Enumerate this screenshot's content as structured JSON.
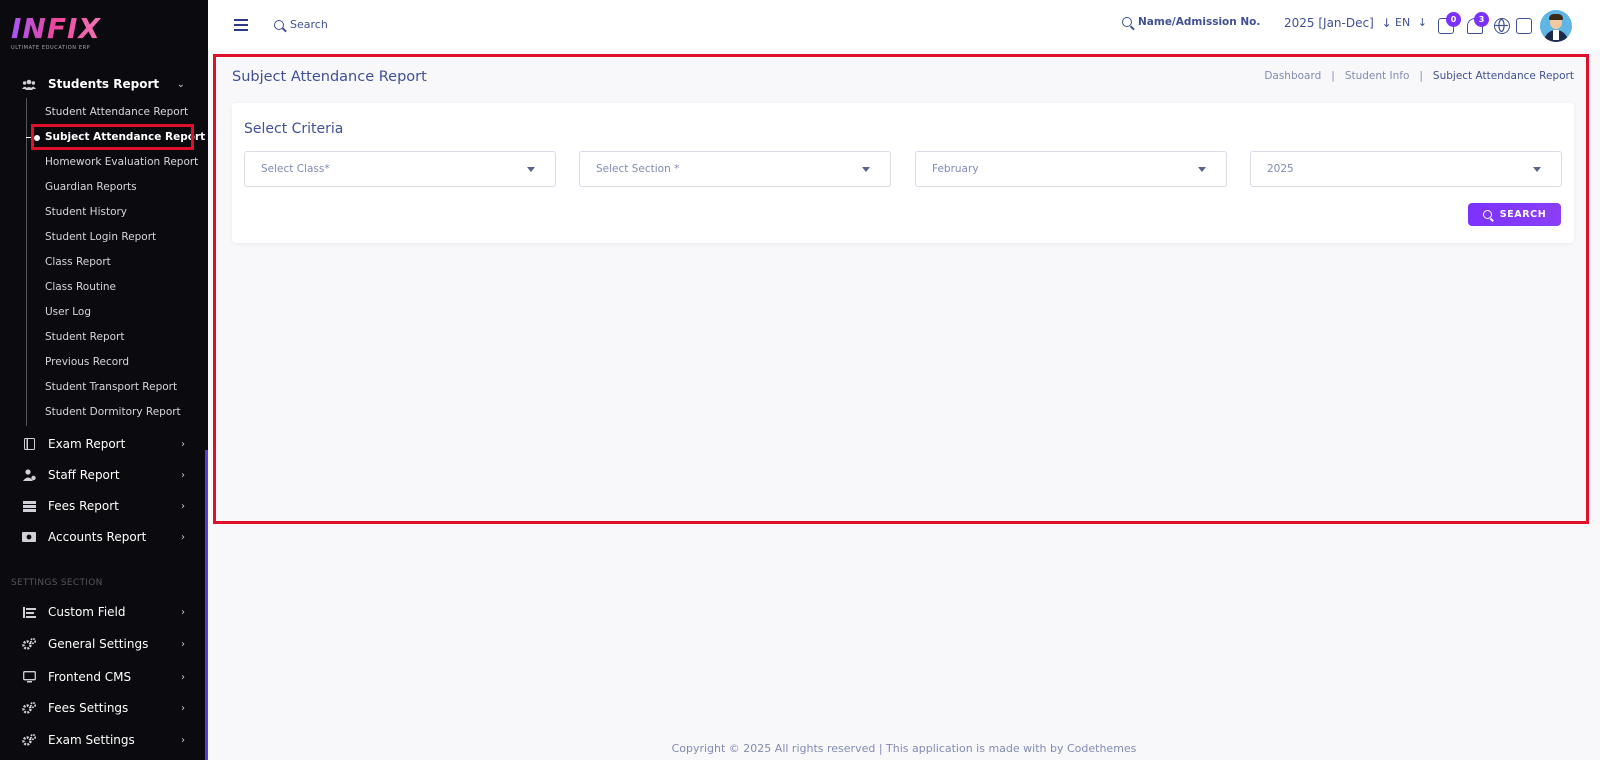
{
  "brand": {
    "name": "INFIX",
    "tagline": "ULTIMATE EDUCATION ERP"
  },
  "sidebar": {
    "students_report": {
      "label": "Students Report",
      "icon": "users-icon"
    },
    "sub_items": [
      "Student Attendance Report",
      "Subject Attendance Report",
      "Homework Evaluation Report",
      "Guardian Reports",
      "Student History",
      "Student Login Report",
      "Class Report",
      "Class Routine",
      "User Log",
      "Student Report",
      "Previous Record",
      "Student Transport Report",
      "Student Dormitory Report"
    ],
    "active_sub": "Subject Attendance Report",
    "groups": [
      {
        "label": "Exam Report",
        "icon": "book-icon"
      },
      {
        "label": "Staff Report",
        "icon": "user-tie-icon"
      },
      {
        "label": "Fees Report",
        "icon": "list-icon"
      },
      {
        "label": "Accounts Report",
        "icon": "money-icon"
      }
    ],
    "settings_section_label": "SETTINGS SECTION",
    "settings": [
      {
        "label": "Custom Field",
        "icon": "fields-icon"
      },
      {
        "label": "General Settings",
        "icon": "gears-icon"
      },
      {
        "label": "Frontend CMS",
        "icon": "monitor-icon"
      },
      {
        "label": "Fees Settings",
        "icon": "gears-icon"
      },
      {
        "label": "Exam Settings",
        "icon": "gears-icon"
      }
    ]
  },
  "topbar": {
    "search_label": "Search",
    "name_search_label": "Name/Admission No.",
    "session": "2025 [Jan-Dec]",
    "language": "EN",
    "messages_count": "0",
    "notifications_count": "3"
  },
  "page": {
    "title": "Subject Attendance Report",
    "breadcrumb": [
      "Dashboard",
      "Student Info",
      "Subject Attendance Report"
    ]
  },
  "criteria": {
    "title": "Select Criteria",
    "class_placeholder": "Select Class*",
    "section_placeholder": "Select Section *",
    "month_value": "February",
    "year_value": "2025",
    "search_button": "SEARCH"
  },
  "footer": "Copyright © 2025 All rights reserved | This application is made with by Codethemes",
  "colors": {
    "accent": "#7c32ff",
    "highlight": "#e0102a",
    "text": "#415094",
    "sidebar_bg": "#0a0a0f"
  }
}
